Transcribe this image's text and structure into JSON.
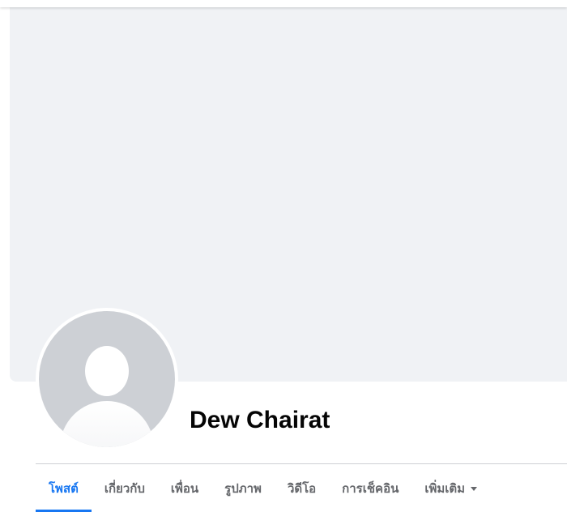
{
  "profile": {
    "name": "Dew Chairat"
  },
  "tabs": [
    {
      "label": "โพสต์",
      "active": true
    },
    {
      "label": "เกี่ยวกับ",
      "active": false
    },
    {
      "label": "เพื่อน",
      "active": false
    },
    {
      "label": "รูปภาพ",
      "active": false
    },
    {
      "label": "วิดีโอ",
      "active": false
    },
    {
      "label": "การเช็คอิน",
      "active": false
    },
    {
      "label": "เพิ่มเติม",
      "active": false,
      "icon": "caret-down-icon"
    }
  ],
  "colors": {
    "accent": "#1877f2",
    "cover": "#f0f2f5",
    "tab_text": "#65676b",
    "avatar_bg": "#cdd0d5"
  }
}
